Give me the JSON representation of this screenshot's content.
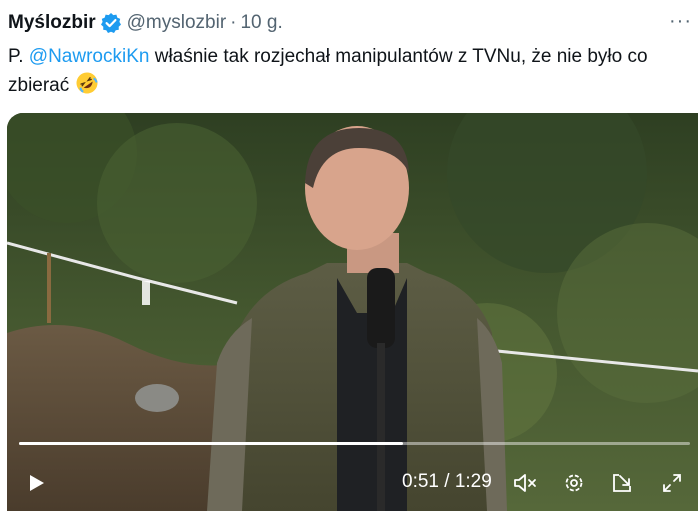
{
  "tweet": {
    "author_name": "Myślozbir",
    "handle": "@myslozbir",
    "separator": "·",
    "time": "10 g.",
    "more_label": "···",
    "text_prefix": "P. ",
    "mention": "@NawrockiKn",
    "text_rest": " właśnie tak rozjechał manipulantów z TVNu, że nie było co zbierać",
    "emoji": "rolling-on-floor-laughing"
  },
  "video": {
    "current_time": "0:51",
    "duration": "1:29",
    "time_separator": " / ",
    "progress": 0.573,
    "muted": true,
    "controls": [
      "play-icon",
      "volume-muted-icon",
      "settings-icon",
      "popout-icon",
      "fullscreen-icon"
    ]
  },
  "colors": {
    "accent": "#1d9bf0",
    "text": "#0f1419",
    "muted_text": "#536471"
  }
}
